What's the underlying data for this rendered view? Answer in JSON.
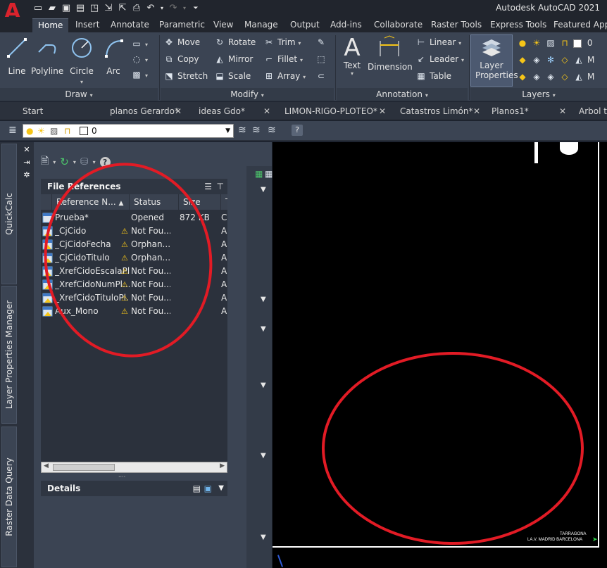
{
  "app": {
    "title": "Autodesk AutoCAD 2021",
    "logo": "A"
  },
  "ribbon_tabs": [
    "Home",
    "Insert",
    "Annotate",
    "Parametric",
    "View",
    "Manage",
    "Output",
    "Add-ins",
    "Collaborate",
    "Raster Tools",
    "Express Tools",
    "Featured Apps"
  ],
  "ribbon": {
    "draw": {
      "label": "Draw",
      "tools": [
        "Line",
        "Polyline",
        "Circle",
        "Arc"
      ]
    },
    "modify": {
      "label": "Modify",
      "tools": [
        "Move",
        "Rotate",
        "Trim",
        "Copy",
        "Mirror",
        "Fillet",
        "Stretch",
        "Scale",
        "Array"
      ]
    },
    "annotation": {
      "label": "Annotation",
      "tools": [
        "Text",
        "Dimension",
        "Linear",
        "Leader",
        "Table"
      ]
    },
    "layers": {
      "label": "Layers",
      "layer_properties": "Layer Properties",
      "current_layer": "0"
    }
  },
  "doc_tabs": [
    "Start",
    "planos Gerardo*",
    "ideas Gdo*",
    "LIMON-RIGO-PLOTEO*",
    "Catastros Limón*",
    "Planos1*",
    "Arbol tr"
  ],
  "layer_toolbar": {
    "current_layer": "0"
  },
  "side_tabs": [
    "QuickCalc",
    "Layer Properties Manager",
    "Raster Data Query"
  ],
  "file_references": {
    "title": "File References",
    "columns": [
      "Reference N...",
      "Status",
      "Size",
      "T"
    ],
    "rows": [
      {
        "name": "Prueba*",
        "status": "Opened",
        "size": "872 KB",
        "type": "C",
        "icon": "drawing-icon",
        "warning": false
      },
      {
        "name": "_CjCido",
        "status": "Not Fou...",
        "size": "",
        "type": "A",
        "icon": "xref-icon",
        "warning": true
      },
      {
        "name": "_CjCidoFecha",
        "status": "Orphan...",
        "size": "",
        "type": "A",
        "icon": "xref-icon",
        "warning": true
      },
      {
        "name": "_CjCidoTitulo",
        "status": "Orphan...",
        "size": "",
        "type": "A",
        "icon": "xref-icon",
        "warning": true
      },
      {
        "name": "_XrefCidoEscalaPl...",
        "status": "Not Fou...",
        "size": "",
        "type": "A",
        "icon": "xref-icon",
        "warning": true
      },
      {
        "name": "_XrefCidoNumPl...",
        "status": "Not Fou...",
        "size": "",
        "type": "A",
        "icon": "xref-icon",
        "warning": true
      },
      {
        "name": "_XrefCidoTituloPl...",
        "status": "Not Fou...",
        "size": "",
        "type": "A",
        "icon": "xref-icon",
        "warning": true
      },
      {
        "name": "Aux_Mono",
        "status": "Not Fou...",
        "size": "",
        "type": "A",
        "icon": "xref-icon",
        "warning": true
      }
    ]
  },
  "details": {
    "title": "Details"
  },
  "canvas": {
    "label_line1": "TARRAGONA",
    "label_line2": "LA.V. MADRID BARCELONA"
  },
  "colors": {
    "annotation_red": "#e21b25",
    "panel_bg": "#3b4453",
    "canvas_bg": "#000000"
  }
}
